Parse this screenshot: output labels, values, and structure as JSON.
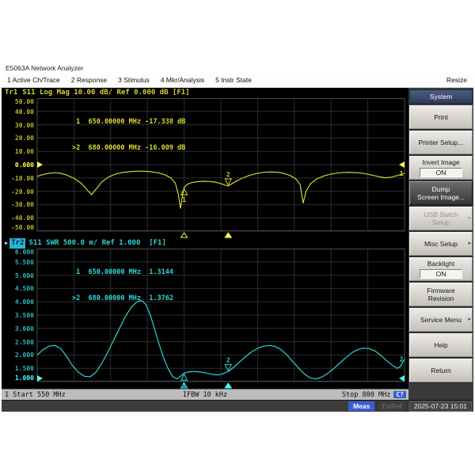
{
  "window": {
    "title": "E5063A Network Analyzer",
    "resize_label": "Resize"
  },
  "menu": {
    "items": [
      "1 Active Ch/Trace",
      "2 Response",
      "3 Stimulus",
      "4 Mkr/Analysis",
      "5 Instr State"
    ]
  },
  "sidebar": {
    "header": "System",
    "buttons": [
      {
        "lines": [
          "Print"
        ]
      },
      {
        "lines": [
          "Printer Setup..."
        ]
      },
      {
        "lines": [
          "Invert Image"
        ],
        "value": "ON"
      },
      {
        "lines": [
          "Dump",
          "Screen Image..."
        ],
        "selected": true
      },
      {
        "lines": [
          "USB Swtch",
          "Setup"
        ],
        "disabled": true,
        "arrow": true
      },
      {
        "lines": [
          "Misc Setup"
        ],
        "arrow": true
      },
      {
        "lines": [
          "Backlight"
        ],
        "value": "ON"
      },
      {
        "lines": [
          "Firmware",
          "Revision"
        ]
      },
      {
        "lines": [
          "Service Menu"
        ],
        "arrow": true
      },
      {
        "lines": [
          "Help"
        ]
      },
      {
        "lines": [
          "Return"
        ]
      }
    ]
  },
  "channel_bar": {
    "channel": "1",
    "start": "Start 550 MHz",
    "ifbw": "IFBW 10 kHz",
    "stop": "Stop 800 MHz",
    "cal_badge": "C?"
  },
  "status_bar": {
    "meas": "Meas",
    "extref": "ExtRef",
    "datetime": "2025-07-23 15:01"
  },
  "chart_data": [
    {
      "type": "line",
      "name": "S11 Log Mag",
      "header": {
        "trace": "Tr1",
        "rest": "S11 Log Mag 10.00 dB/ Ref 0.000 dB [F1]"
      },
      "x_start_mhz": 550,
      "x_stop_mhz": 800,
      "ylim": [
        -50,
        50
      ],
      "xdiv": 10,
      "ydiv": 10,
      "grid": true,
      "yticks": [
        "50.00",
        "40.00",
        "30.00",
        "20.00",
        "10.00",
        "0.000",
        "-10.00",
        "-20.00",
        "-30.00",
        "-40.00",
        "-50.00"
      ],
      "ref_tick_index": 5,
      "ref_value": 0,
      "color": "#d3d32f",
      "bright": "#ffff46",
      "end_label": "1",
      "readout_lines": [
        " 1  650.00000 MHz -17.338 dB",
        ">2  680.00000 MHz -16.009 dB"
      ],
      "markers": [
        {
          "n": "1",
          "f": 650,
          "v": -17.338,
          "active": false,
          "pos": "below"
        },
        {
          "n": "2",
          "f": 680,
          "v": -16.009,
          "active": true,
          "pos": "above"
        }
      ],
      "points": [
        [
          550,
          -8.8
        ],
        [
          554,
          -7.4
        ],
        [
          558,
          -6.5
        ],
        [
          562,
          -6.1
        ],
        [
          566,
          -6.5
        ],
        [
          570,
          -7.8
        ],
        [
          575,
          -10.2
        ],
        [
          580,
          -14.0
        ],
        [
          584,
          -19.0
        ],
        [
          587,
          -22.5
        ],
        [
          590,
          -18.5
        ],
        [
          594,
          -13.0
        ],
        [
          598,
          -9.6
        ],
        [
          603,
          -7.2
        ],
        [
          608,
          -5.9
        ],
        [
          614,
          -5.1
        ],
        [
          620,
          -4.9
        ],
        [
          626,
          -5.1
        ],
        [
          632,
          -6.1
        ],
        [
          637,
          -7.6
        ],
        [
          641,
          -10.0
        ],
        [
          644,
          -14.0
        ],
        [
          646,
          -22.0
        ],
        [
          647.5,
          -33.0
        ],
        [
          649,
          -22.5
        ],
        [
          650,
          -17.3
        ],
        [
          652,
          -14.8
        ],
        [
          655,
          -13.5
        ],
        [
          659,
          -12.8
        ],
        [
          663,
          -12.5
        ],
        [
          667,
          -12.6
        ],
        [
          671,
          -13.1
        ],
        [
          675,
          -14.2
        ],
        [
          678,
          -15.4
        ],
        [
          680,
          -16.0
        ],
        [
          682,
          -14.7
        ],
        [
          685,
          -12.7
        ],
        [
          689,
          -10.4
        ],
        [
          694,
          -8.2
        ],
        [
          699,
          -6.7
        ],
        [
          704,
          -5.8
        ],
        [
          709,
          -5.4
        ],
        [
          714,
          -5.7
        ],
        [
          718,
          -6.6
        ],
        [
          722,
          -8.1
        ],
        [
          726,
          -10.6
        ],
        [
          729,
          -15.0
        ],
        [
          731,
          -29.0
        ],
        [
          733,
          -20.0
        ],
        [
          736,
          -14.4
        ],
        [
          740,
          -10.9
        ],
        [
          745,
          -8.5
        ],
        [
          750,
          -7.0
        ],
        [
          756,
          -6.1
        ],
        [
          762,
          -5.7
        ],
        [
          768,
          -6.0
        ],
        [
          773,
          -6.7
        ],
        [
          778,
          -7.9
        ],
        [
          783,
          -9.1
        ],
        [
          787,
          -9.9
        ],
        [
          791,
          -9.4
        ],
        [
          795,
          -8.2
        ],
        [
          798,
          -7.2
        ],
        [
          800,
          -6.6
        ]
      ]
    },
    {
      "type": "line",
      "name": "S11 SWR",
      "header": {
        "active_indicator": "▶",
        "trace": "Tr2",
        "rest": "S11 SWR 500.0 m/ Ref 1.000  [F1]"
      },
      "x_start_mhz": 550,
      "x_stop_mhz": 800,
      "ylim": [
        1,
        6
      ],
      "xdiv": 10,
      "ydiv": 10,
      "grid": true,
      "yticks": [
        "6.000",
        "5.500",
        "5.000",
        "4.500",
        "4.000",
        "3.500",
        "3.000",
        "2.500",
        "2.000",
        "1.500",
        "1.000"
      ],
      "ref_tick_index": 10,
      "ref_value": 1,
      "color": "#2fd3d3",
      "bright": "#46ffff",
      "end_label": "2",
      "readout_lines": [
        " 1  650.00000 MHz  1.3144",
        ">2  680.00000 MHz  1.3762"
      ],
      "markers": [
        {
          "n": "1",
          "f": 650,
          "v": 1.3144,
          "active": false,
          "pos": "below"
        },
        {
          "n": "2",
          "f": 680,
          "v": 1.3762,
          "active": true,
          "pos": "above"
        }
      ],
      "points": [
        [
          550,
          2.0
        ],
        [
          554,
          2.2
        ],
        [
          558,
          2.33
        ],
        [
          562,
          2.36
        ],
        [
          566,
          2.24
        ],
        [
          570,
          1.95
        ],
        [
          574,
          1.6
        ],
        [
          578,
          1.35
        ],
        [
          582,
          1.2
        ],
        [
          586,
          1.18
        ],
        [
          590,
          1.35
        ],
        [
          594,
          1.7
        ],
        [
          598,
          2.1
        ],
        [
          602,
          2.55
        ],
        [
          606,
          3.0
        ],
        [
          610,
          3.45
        ],
        [
          614,
          3.8
        ],
        [
          618,
          4.0
        ],
        [
          621,
          4.05
        ],
        [
          624,
          3.9
        ],
        [
          627,
          3.5
        ],
        [
          630,
          2.95
        ],
        [
          633,
          2.4
        ],
        [
          636,
          1.9
        ],
        [
          639,
          1.5
        ],
        [
          642,
          1.2
        ],
        [
          645,
          1.1
        ],
        [
          648,
          1.22
        ],
        [
          650,
          1.3144
        ],
        [
          653,
          1.36
        ],
        [
          657,
          1.38
        ],
        [
          661,
          1.36
        ],
        [
          665,
          1.32
        ],
        [
          669,
          1.27
        ],
        [
          673,
          1.25
        ],
        [
          676,
          1.29
        ],
        [
          680,
          1.3762
        ],
        [
          684,
          1.55
        ],
        [
          688,
          1.75
        ],
        [
          692,
          1.95
        ],
        [
          696,
          2.12
        ],
        [
          700,
          2.25
        ],
        [
          704,
          2.33
        ],
        [
          708,
          2.36
        ],
        [
          712,
          2.32
        ],
        [
          716,
          2.2
        ],
        [
          720,
          2.0
        ],
        [
          724,
          1.75
        ],
        [
          728,
          1.5
        ],
        [
          732,
          1.28
        ],
        [
          736,
          1.13
        ],
        [
          740,
          1.1
        ],
        [
          744,
          1.18
        ],
        [
          748,
          1.32
        ],
        [
          752,
          1.5
        ],
        [
          756,
          1.7
        ],
        [
          760,
          1.9
        ],
        [
          764,
          2.08
        ],
        [
          768,
          2.2
        ],
        [
          772,
          2.26
        ],
        [
          776,
          2.24
        ],
        [
          780,
          2.15
        ],
        [
          784,
          1.98
        ],
        [
          788,
          1.78
        ],
        [
          792,
          1.6
        ],
        [
          795,
          1.5
        ],
        [
          797,
          1.55
        ],
        [
          800,
          1.85
        ]
      ]
    }
  ]
}
